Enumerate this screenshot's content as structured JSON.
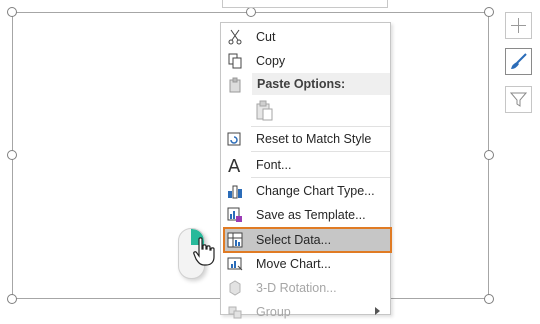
{
  "context_menu": {
    "items": [
      {
        "key": "cut",
        "label": "Cut",
        "icon": "scissors-icon"
      },
      {
        "key": "copy",
        "label": "Copy",
        "icon": "copy-icon"
      },
      {
        "key": "paste_header",
        "label": "Paste Options:",
        "icon": "paste-icon"
      },
      {
        "key": "paste_option",
        "label": "",
        "icon": "paste-clipboard-icon"
      },
      {
        "key": "reset",
        "label": "Reset to Match Style",
        "icon": "reset-style-icon"
      },
      {
        "key": "font",
        "label": "Font...",
        "icon": "font-icon"
      },
      {
        "key": "change_chart_type",
        "label": "Change Chart Type...",
        "icon": "bar-chart-icon"
      },
      {
        "key": "save_template",
        "label": "Save as Template...",
        "icon": "save-template-icon"
      },
      {
        "key": "select_data",
        "label": "Select Data...",
        "icon": "table-chart-icon",
        "selected": true
      },
      {
        "key": "move_chart",
        "label": "Move Chart...",
        "icon": "move-chart-icon"
      },
      {
        "key": "rotation",
        "label": "3-D Rotation...",
        "icon": "cube-icon",
        "disabled": true
      },
      {
        "key": "group",
        "label": "Group",
        "icon": "group-icon",
        "disabled": true,
        "submenu": true
      }
    ]
  },
  "side_buttons": [
    {
      "name": "chart-elements-button",
      "icon": "plus-icon"
    },
    {
      "name": "chart-styles-button",
      "icon": "brush-icon"
    },
    {
      "name": "chart-filters-button",
      "icon": "filter-icon"
    }
  ],
  "colors": {
    "highlight_border": "#e07b24",
    "highlight_fill": "#c6c6c6",
    "mouse_button": "#27b99a",
    "brush_blue": "#2b6cb8"
  }
}
